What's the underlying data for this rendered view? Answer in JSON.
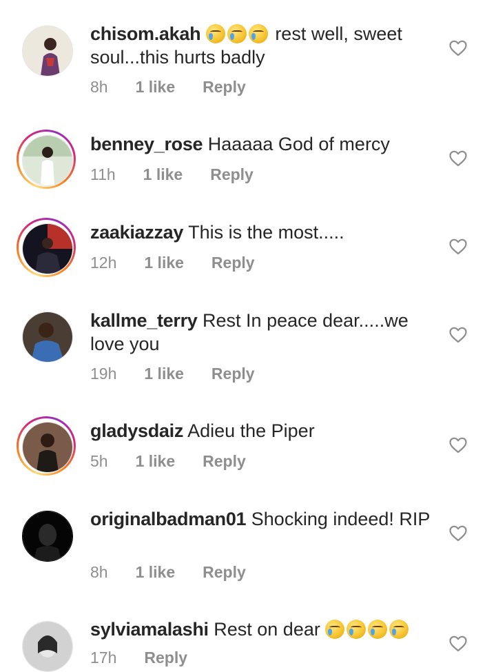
{
  "comments": [
    {
      "username": "chisom.akah",
      "text": "rest well, sweet soul...this hurts badly",
      "emojis": [
        "crying-face-emoji",
        "crying-face-emoji",
        "crying-face-emoji"
      ],
      "time": "8h",
      "likes": "1 like",
      "reply": "Reply",
      "has_story_ring": false,
      "avatar_colors": [
        "#e9e4d8",
        "#6b3d6e"
      ]
    },
    {
      "username": "benney_rose",
      "text": "Haaaaa God of mercy",
      "emojis": [],
      "time": "11h",
      "likes": "1 like",
      "reply": "Reply",
      "has_story_ring": true,
      "avatar_colors": [
        "#c9d9c4",
        "#f4f4f0"
      ]
    },
    {
      "username": "zaakiazzay",
      "text": "This is the most.....",
      "emojis": [],
      "time": "12h",
      "likes": "1 like",
      "reply": "Reply",
      "has_story_ring": true,
      "avatar_colors": [
        "#1a1a2a",
        "#c0392b"
      ]
    },
    {
      "username": "kallme_terry",
      "text": "Rest In peace dear.....we love you",
      "emojis": [],
      "time": "19h",
      "likes": "1 like",
      "reply": "Reply",
      "has_story_ring": false,
      "avatar_colors": [
        "#5a4a3a",
        "#3b6db5"
      ]
    },
    {
      "username": "gladysdaiz",
      "text": "Adieu the Piper",
      "emojis": [],
      "time": "5h",
      "likes": "1 like",
      "reply": "Reply",
      "has_story_ring": true,
      "avatar_colors": [
        "#8a5a40",
        "#2e2a26"
      ]
    },
    {
      "username": "originalbadman01",
      "text": "Shocking indeed! RIP",
      "emojis": [],
      "time": "8h",
      "likes": "1 like",
      "reply": "Reply",
      "has_story_ring": false,
      "avatar_colors": [
        "#000000",
        "#3a3a3a"
      ]
    },
    {
      "username": "sylviamalashi",
      "text": "Rest on dear",
      "emojis_after": [
        "crying-face-emoji",
        "crying-face-emoji",
        "crying-face-emoji",
        "crying-face-emoji"
      ],
      "time": "17h",
      "likes": "",
      "reply": "Reply",
      "has_story_ring": false,
      "avatar_colors": [
        "#cfcfcf",
        "#3a3a3a"
      ]
    }
  ],
  "icons": {
    "like": "heart-outline-icon"
  },
  "colors": {
    "username": "#262626",
    "meta": "#8e8e8e",
    "heart": "#8e8e8e"
  }
}
